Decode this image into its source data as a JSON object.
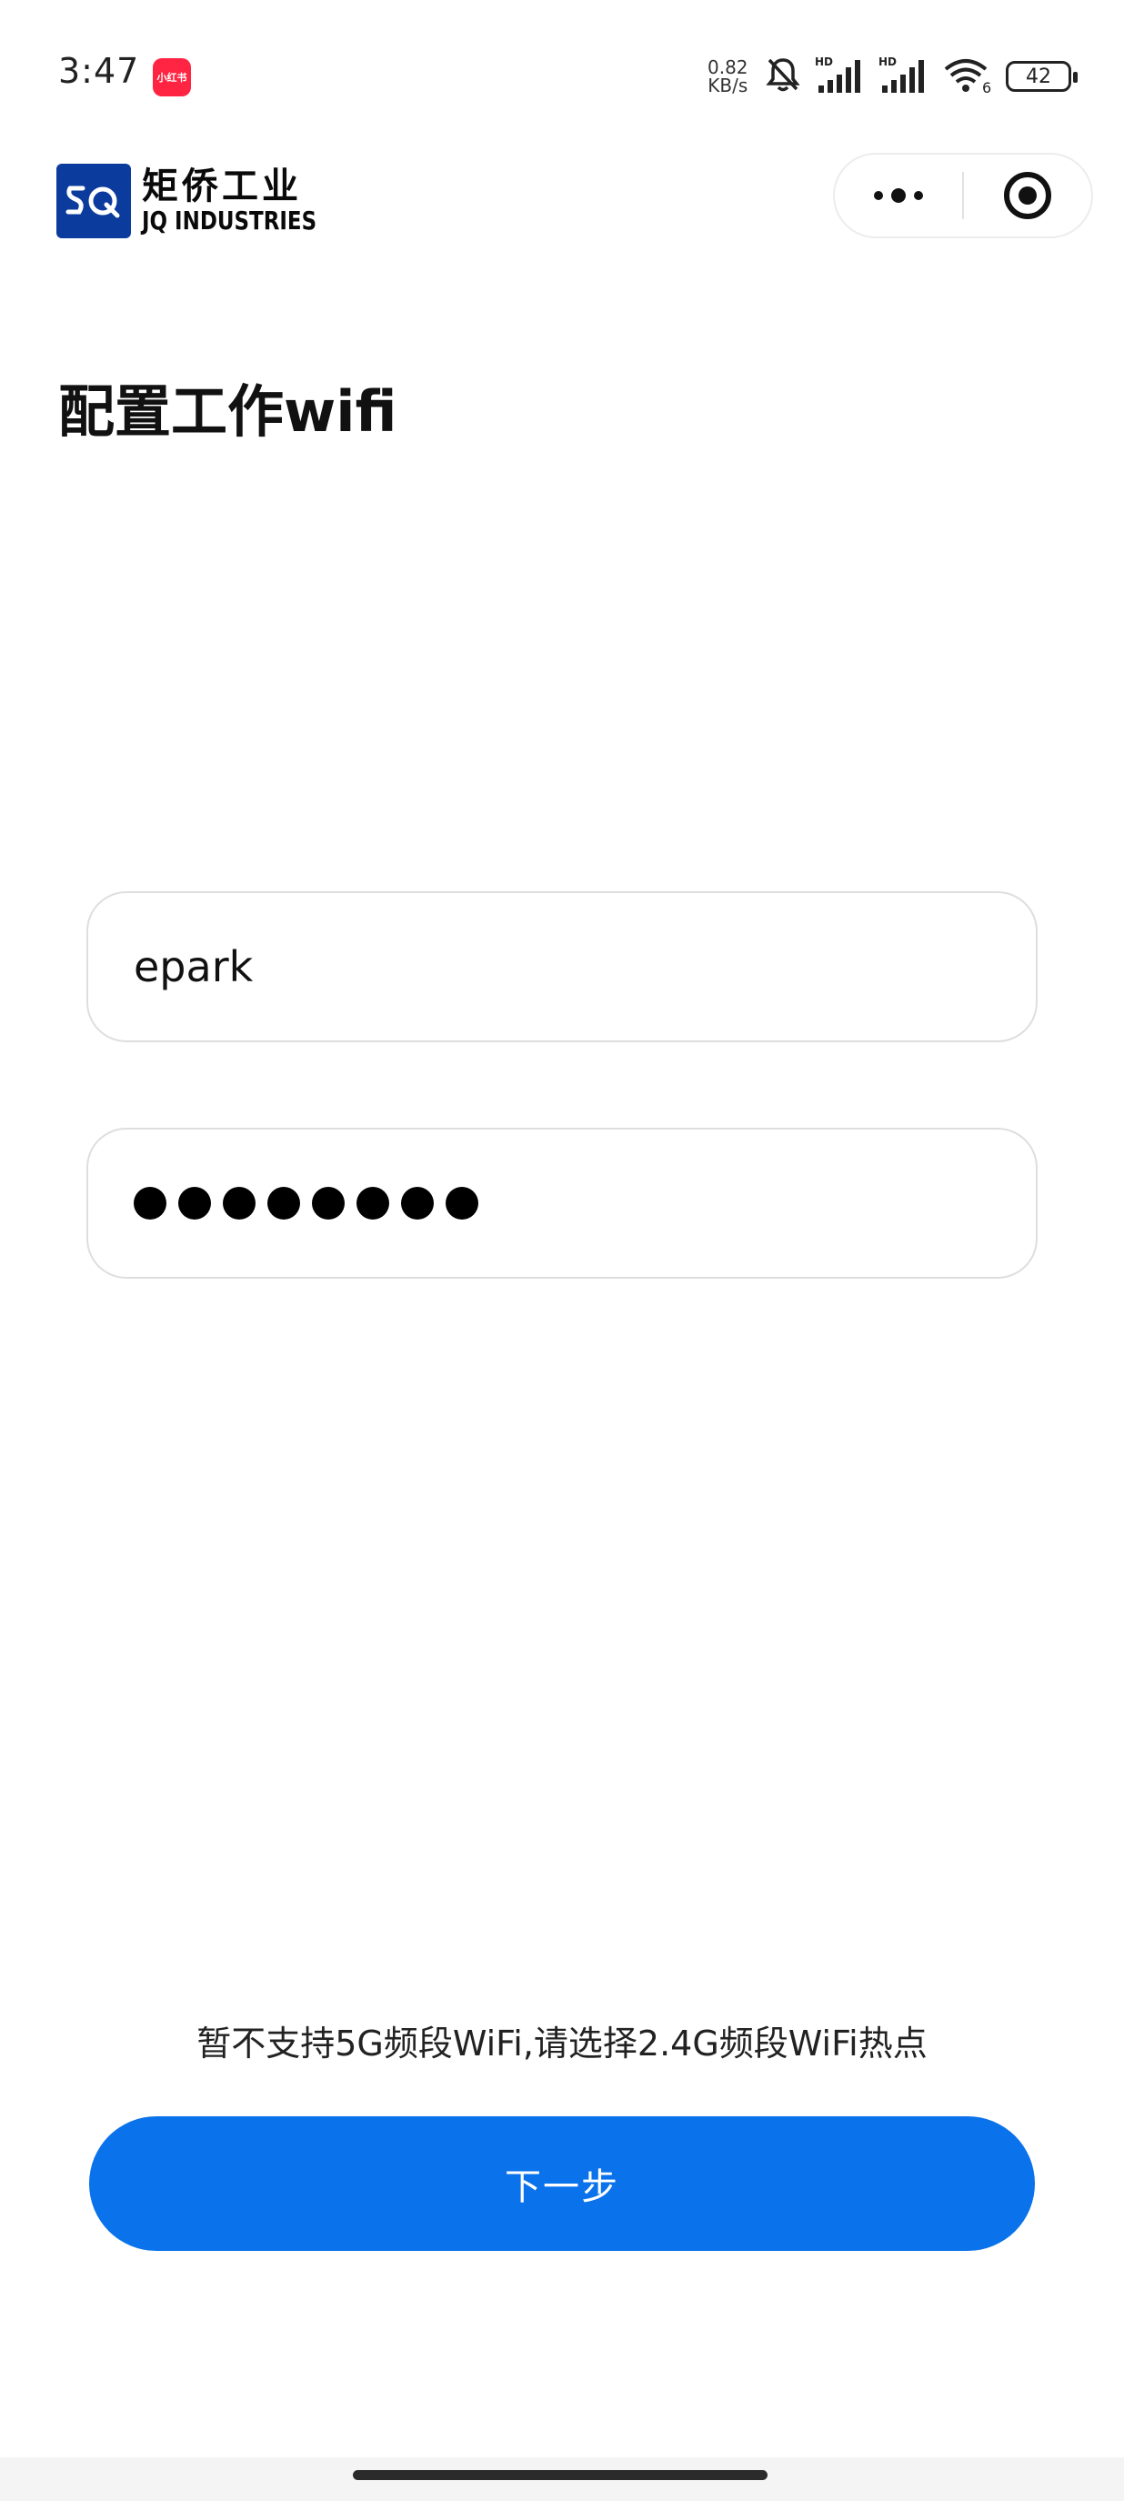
{
  "status_bar": {
    "time": "3:47",
    "app_badge_text": "小红书",
    "net_speed_value": "0.82",
    "net_speed_unit": "KB/s",
    "wifi_badge": "6",
    "hd_label_1": "HD",
    "hd_label_2": "HD",
    "battery": "42"
  },
  "header": {
    "logo_cn": "矩侨工业",
    "logo_en": "JQ INDUSTRIES"
  },
  "page": {
    "title": "配置工作wifi"
  },
  "form": {
    "ssid_value": "epark",
    "password_masked_count": 8
  },
  "footer": {
    "hint": "暂不支持5G频段WiFi,请选择2.4G频段WiFi热点",
    "next_label": "下一步"
  },
  "colors": {
    "primary_button": "#0a72ea",
    "logo_blue": "#0b3b9c",
    "badge_red": "#ff2442"
  }
}
